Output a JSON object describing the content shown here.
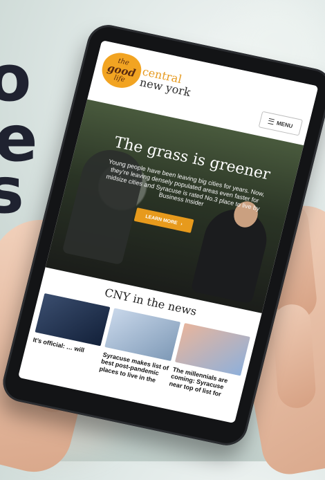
{
  "hero_letters": [
    "o",
    "e",
    "s"
  ],
  "site": {
    "logo_line1": "the",
    "logo_line2": "good",
    "logo_line3": "life",
    "logo_right1": "central",
    "logo_right2": "new york",
    "menu_label": "MENU"
  },
  "hero": {
    "title": "The grass is greener",
    "body": "Young people have been leaving big cities for years. Now, they’re leaving densely populated areas even faster for midsize cities and Syracuse is rated No.3 place to live by Business Insider",
    "button_label": "LEARN MORE"
  },
  "news": {
    "title": "CNY in the news",
    "items": [
      {
        "headline": "It’s official: … will"
      },
      {
        "headline": "Syracuse makes list of best post-pandemic places to live in the"
      },
      {
        "headline": "The millennials are coming: Syracuse near top of list for"
      }
    ]
  },
  "colors": {
    "accent": "#e79a1c",
    "dark": "#1f2230"
  }
}
